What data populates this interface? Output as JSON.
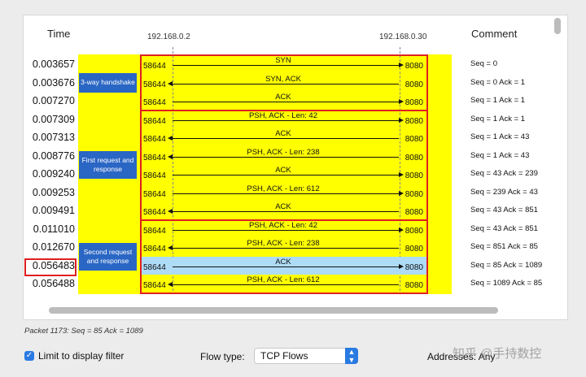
{
  "headers": {
    "time": "Time",
    "host_left": "192.168.0.2",
    "host_right": "192.168.0.30",
    "comment": "Comment"
  },
  "flows": [
    {
      "time": "0.003657",
      "label": "SYN",
      "dir": "right",
      "comment": "Seq = 0"
    },
    {
      "time": "0.003676",
      "label": "SYN, ACK",
      "dir": "left",
      "comment": "Seq = 0 Ack = 1"
    },
    {
      "time": "0.007270",
      "label": "ACK",
      "dir": "right",
      "comment": "Seq = 1 Ack = 1"
    },
    {
      "time": "0.007309",
      "label": "PSH, ACK - Len: 42",
      "dir": "right",
      "comment": "Seq = 1 Ack = 1"
    },
    {
      "time": "0.007313",
      "label": "ACK",
      "dir": "left",
      "comment": "Seq = 1 Ack = 43"
    },
    {
      "time": "0.008776",
      "label": "PSH, ACK - Len: 238",
      "dir": "left",
      "comment": "Seq = 1 Ack = 43"
    },
    {
      "time": "0.009240",
      "label": "ACK",
      "dir": "right",
      "comment": "Seq = 43 Ack = 239"
    },
    {
      "time": "0.009253",
      "label": "PSH, ACK - Len: 612",
      "dir": "right",
      "comment": "Seq = 239 Ack = 43"
    },
    {
      "time": "0.009491",
      "label": "ACK",
      "dir": "left",
      "comment": "Seq = 43 Ack = 851"
    },
    {
      "time": "0.011010",
      "label": "PSH, ACK - Len: 42",
      "dir": "right",
      "comment": "Seq = 43 Ack = 851"
    },
    {
      "time": "0.012670",
      "label": "PSH, ACK - Len: 238",
      "dir": "left",
      "comment": "Seq = 851 Ack = 85"
    },
    {
      "time": "0.056483",
      "label": "ACK",
      "dir": "right",
      "comment": "Seq = 85 Ack = 1089",
      "selected": true
    },
    {
      "time": "0.056488",
      "label": "PSH, ACK - Len: 612",
      "dir": "left",
      "comment": "Seq = 1089 Ack = 85"
    }
  ],
  "ports": {
    "left": "58644",
    "right": "8080"
  },
  "groups": [
    {
      "label": "3-way handshake",
      "start": 0,
      "end": 2
    },
    {
      "label": "First request and response",
      "start": 3,
      "end": 8
    },
    {
      "label": "Second request and response",
      "start": 9,
      "end": 12
    }
  ],
  "highlight_time_row": 11,
  "status": "Packet 1173: Seq = 85 Ack = 1089",
  "controls": {
    "limit_filter_label": "Limit to display filter",
    "limit_filter_checked": true,
    "flow_type_label": "Flow type:",
    "flow_type_value": "TCP Flows",
    "address_label": "Addresses: Any"
  },
  "watermark": "知乎 @手持数控",
  "colors": {
    "band": "#ffff00",
    "selected": "#aedcf7",
    "group_border": "#e02020",
    "group_label_bg": "#2a66c4",
    "accent": "#2a7ae2"
  }
}
